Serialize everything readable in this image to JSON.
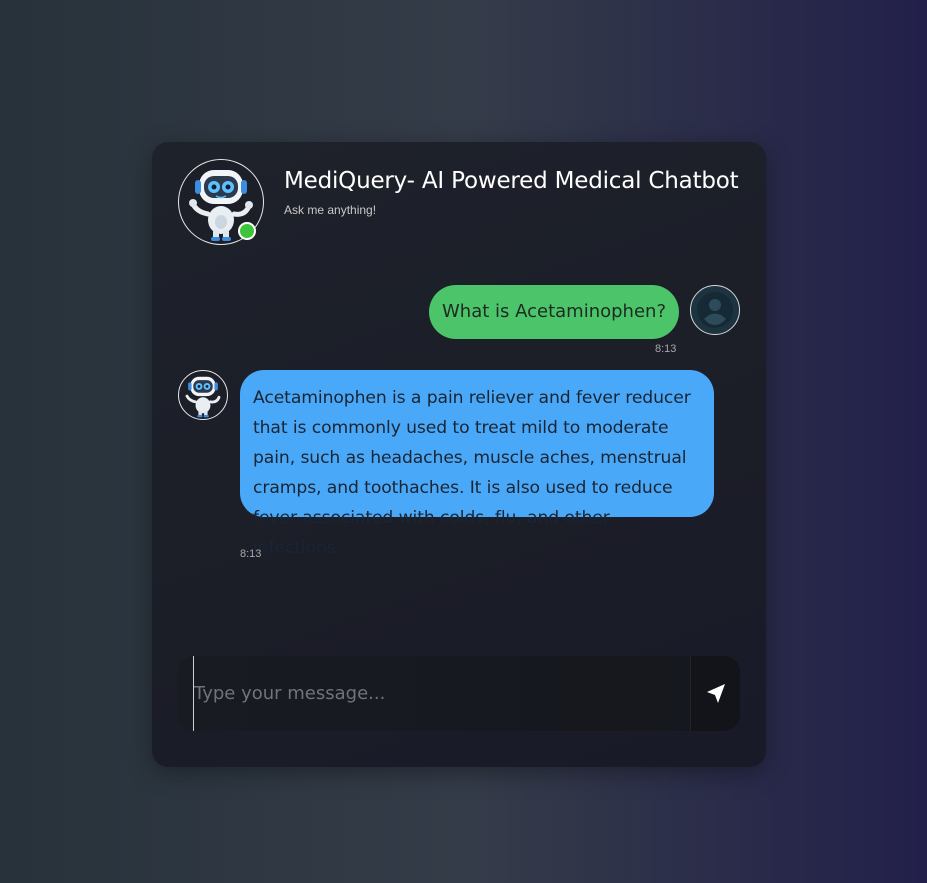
{
  "header": {
    "title": "MediQuery- AI Powered Medical Chatbot",
    "subtitle": "Ask me anything!",
    "status": "online",
    "status_color": "#3ec43a",
    "avatar_icon": "robot-mascot-icon"
  },
  "messages": [
    {
      "sender": "user",
      "text": "What is Acetaminophen?",
      "time": "8:13",
      "bubble_color": "#4bc46a",
      "avatar_icon": "user-silhouette-icon"
    },
    {
      "sender": "bot",
      "text": "Acetaminophen is a pain reliever and fever reducer that is commonly used to treat mild to moderate pain, such as headaches, muscle aches, menstrual cramps, and toothaches. It is also used to reduce fever associated with colds, flu, and other infections.",
      "time": "8:13",
      "bubble_color": "#4aa8f8",
      "avatar_icon": "robot-mascot-icon"
    }
  ],
  "composer": {
    "value": "",
    "placeholder": "Type your message...",
    "send_icon": "send-arrow-icon"
  },
  "colors": {
    "card_background": "#1c1e28",
    "accent_user": "#4bc46a",
    "accent_bot": "#4aa8f8"
  }
}
